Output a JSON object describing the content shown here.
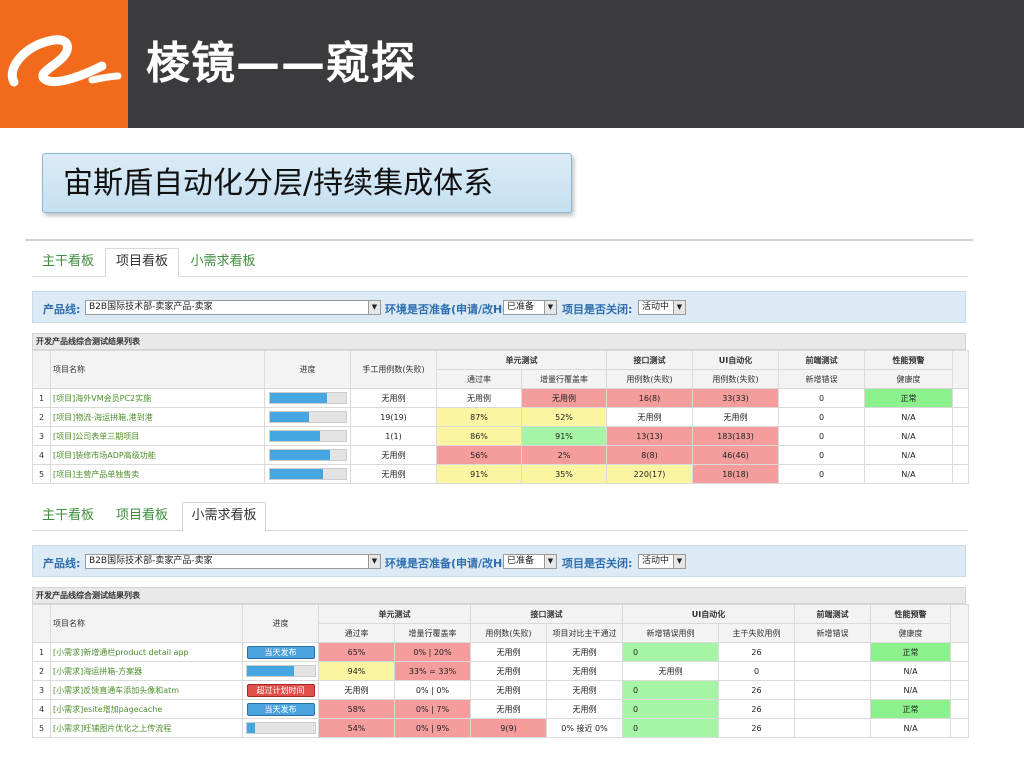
{
  "header": {
    "title": "棱镜——窥探",
    "subtitle": "宙斯盾自动化分层/持续集成体系",
    "logo_icon": "alibaba-logo-icon"
  },
  "colors": {
    "accent": "#f26b1d",
    "header_bg": "#3b3b3d",
    "red": "#f59d9d",
    "yellow": "#fbf5a3",
    "green": "#a6f5a6",
    "progress": "#45a6e0",
    "overdue": "#e0504a"
  },
  "panel1": {
    "tabs": [
      {
        "label": "主干看板"
      },
      {
        "label": "项目看板"
      },
      {
        "label": "小需求看板"
      }
    ],
    "active_tab": 1,
    "filter": {
      "product_line_label": "产品线:",
      "product_line_value": "B2B国际技术部-卖家产品-卖家",
      "env_label": "环境是否准备(申请/改Host):",
      "env_value": "已准备",
      "closed_label": "项目是否关闭:",
      "closed_value": "活动中"
    },
    "table_title": "开发产品线综合测试结果列表",
    "headers": {
      "name": "项目名称",
      "progress": "进度",
      "manual": "手工用例数(失败)",
      "unit": "单元测试",
      "unit_pass": "通过率",
      "unit_cov": "增量行覆盖率",
      "api": "接口测试",
      "api_cases": "用例数(失败)",
      "ui": "UI自动化",
      "ui_cases": "用例数(失败)",
      "fe": "前端测试",
      "fe_new": "新增错误",
      "perf": "性能预警",
      "perf_health": "健康度"
    },
    "rows": [
      {
        "idx": "1",
        "name": "[项目]海外VM会员PC2实施",
        "progress": 0.75,
        "manual": "无用例",
        "unit_pass": "无用例",
        "unit_cov": "无用例",
        "api": "16(8)",
        "ui": "33(33)",
        "fe": "0",
        "perf": "正常"
      },
      {
        "idx": "2",
        "name": "[项目]物流-海运拼箱,港到港",
        "progress": 0.52,
        "manual": "19(19)",
        "unit_pass": "87%",
        "unit_cov": "52%",
        "api": "无用例",
        "ui": "无用例",
        "fe": "0",
        "perf": "N/A"
      },
      {
        "idx": "3",
        "name": "[项目]公司表单三期项目",
        "progress": 0.66,
        "manual": "1(1)",
        "unit_pass": "86%",
        "unit_cov": "91%",
        "api": "13(13)",
        "ui": "183(183)",
        "fe": "0",
        "perf": "N/A"
      },
      {
        "idx": "4",
        "name": "[项目]装修市场ADP高级功能",
        "progress": 0.8,
        "manual": "无用例",
        "unit_pass": "56%",
        "unit_cov": "2%",
        "api": "8(8)",
        "ui": "46(46)",
        "fe": "0",
        "perf": "N/A"
      },
      {
        "idx": "5",
        "name": "[项目]主营产品单独售卖",
        "progress": 0.7,
        "manual": "无用例",
        "unit_pass": "91%",
        "unit_cov": "35%",
        "api": "220(17)",
        "ui": "18(18)",
        "fe": "0",
        "perf": "N/A"
      }
    ]
  },
  "panel2": {
    "tabs": [
      {
        "label": "主干看板"
      },
      {
        "label": "项目看板"
      },
      {
        "label": "小需求看板"
      }
    ],
    "active_tab": 2,
    "filter": {
      "product_line_label": "产品线:",
      "product_line_value": "B2B国际技术部-卖家产品-卖家",
      "env_label": "环境是否准备(申请/改Host):",
      "env_value": "已准备",
      "closed_label": "项目是否关闭:",
      "closed_value": "活动中"
    },
    "table_title": "开发产品线综合测试结果列表",
    "headers": {
      "name": "项目名称",
      "progress": "进度",
      "unit": "单元测试",
      "unit_pass": "通过率",
      "unit_cov": "增量行覆盖率",
      "api": "接口测试",
      "api_cases": "用例数(失败)",
      "api_cmp": "项目对比主干通过",
      "ui": "UI自动化",
      "ui_new": "新增错误用例",
      "ui_trunk": "主干失败用例",
      "fe": "前端测试",
      "fe_new": "新增错误",
      "perf": "性能预警",
      "perf_health": "健康度"
    },
    "rows": [
      {
        "idx": "1",
        "name": "[小需求]新增通栏product detail app",
        "status": "当天发布",
        "progress": null,
        "unit_pass": "65%",
        "unit_cov": "0% | 20%",
        "api": "无用例",
        "api_cmp": "无用例",
        "ui_new": "0",
        "ui_trunk": "26",
        "fe": "",
        "perf": "正常"
      },
      {
        "idx": "2",
        "name": "[小需求]海运拼箱-方案器",
        "status": "",
        "progress": 0.7,
        "unit_pass": "94%",
        "unit_cov": "33% = 33%",
        "api": "无用例",
        "api_cmp": "无用例",
        "ui_new": "无用例",
        "ui_trunk": "0",
        "fe": "",
        "perf": "N/A"
      },
      {
        "idx": "3",
        "name": "[小需求]反馈直通车添加头像和atm",
        "status": "超过计划时间",
        "progress": null,
        "unit_pass": "无用例",
        "unit_cov": "0% | 0%",
        "api": "无用例",
        "api_cmp": "无用例",
        "ui_new": "0",
        "ui_trunk": "26",
        "fe": "",
        "perf": "N/A"
      },
      {
        "idx": "4",
        "name": "[小需求]esite增加pagecache",
        "status": "当天发布",
        "progress": null,
        "unit_pass": "58%",
        "unit_cov": "0% | 7%",
        "api": "无用例",
        "api_cmp": "无用例",
        "ui_new": "0",
        "ui_trunk": "26",
        "fe": "",
        "perf": "正常"
      },
      {
        "idx": "5",
        "name": "[小需求]旺铺图片优化之上传流程",
        "status": "",
        "progress": 0.12,
        "unit_pass": "54%",
        "unit_cov": "0% | 9%",
        "api": "9(9)",
        "api_cmp": "0% 接近 0%",
        "ui_new": "0",
        "ui_trunk": "26",
        "fe": "",
        "perf": "N/A"
      }
    ]
  }
}
